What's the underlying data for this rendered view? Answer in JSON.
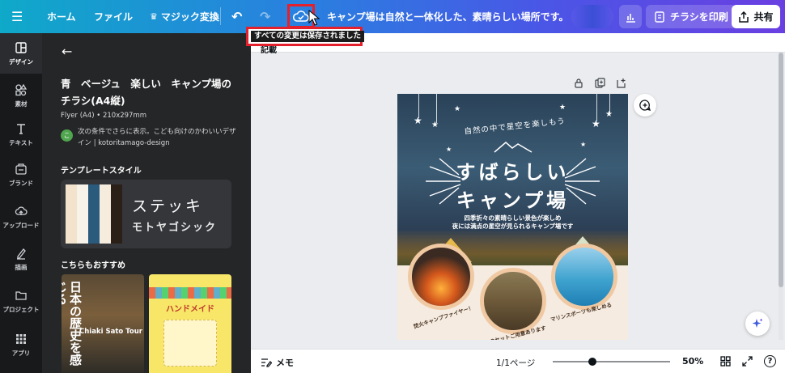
{
  "topbar": {
    "home": "ホーム",
    "file": "ファイル",
    "magic": "マジック変換",
    "document_title": "キャンプ場は自然と一体化した、素晴らしい場所です。ここ...",
    "print_label": "チラシを印刷",
    "share_label": "共有"
  },
  "tooltip": "すべての変更は保存されました",
  "rail": [
    {
      "label": "デザイン",
      "icon": "layout-icon"
    },
    {
      "label": "素材",
      "icon": "shapes-icon"
    },
    {
      "label": "テキスト",
      "icon": "text-icon"
    },
    {
      "label": "ブランド",
      "icon": "brand-icon"
    },
    {
      "label": "アップロード",
      "icon": "upload-icon"
    },
    {
      "label": "描画",
      "icon": "draw-icon"
    },
    {
      "label": "プロジェクト",
      "icon": "folder-icon"
    },
    {
      "label": "アプリ",
      "icon": "apps-icon"
    }
  ],
  "panel": {
    "title": "青　ベージュ　楽しい　キャンプ場のチラシ(A4縦)",
    "meta": "Flyer (A4) • 210x297mm",
    "author_initial": "こ",
    "author_text": "次の条件でさらに表示。こども向けのかわいいデザイン | kotoritamago-design",
    "template_style_heading": "テンプレートスタイル",
    "font_sample_1": "ステッキ",
    "font_sample_2": "モトヤゴシック",
    "swatches": [
      "#f3e3cc",
      "#f7f2ea",
      "#2a5b7d",
      "#f6ecde",
      "#2a2018"
    ],
    "recommend_heading": "こちらもおすすめ",
    "thumb1_title": "日本の歴史を感じる",
    "thumb1_sub": "Chiaki Sato Tour",
    "thumb2_title": "ハンドメイド"
  },
  "canvas": {
    "note_text": "記載"
  },
  "flyer": {
    "arc_text": "自然の中で星空を楽しもう",
    "headline_1": "すばらしい",
    "headline_2": "キャンプ場",
    "sub_1": "四季折々の素晴らしい景色が楽しめ",
    "sub_2": "夜には満点の星空が見られるキャンプ場です",
    "cap_1": "焚火キャンプファイヤー！",
    "cap_2": "BBQセットご用意あります",
    "cap_3": "マリンスポーツも楽しめる"
  },
  "bottombar": {
    "memo": "メモ",
    "page_indicator": "1/1ページ",
    "zoom": "50%",
    "zoom_level": 0.34
  },
  "colors": {
    "accent": "#8b3dff",
    "highlight_box": "#e4202c",
    "rail_bg": "#18191b",
    "panel_bg": "#252627"
  }
}
